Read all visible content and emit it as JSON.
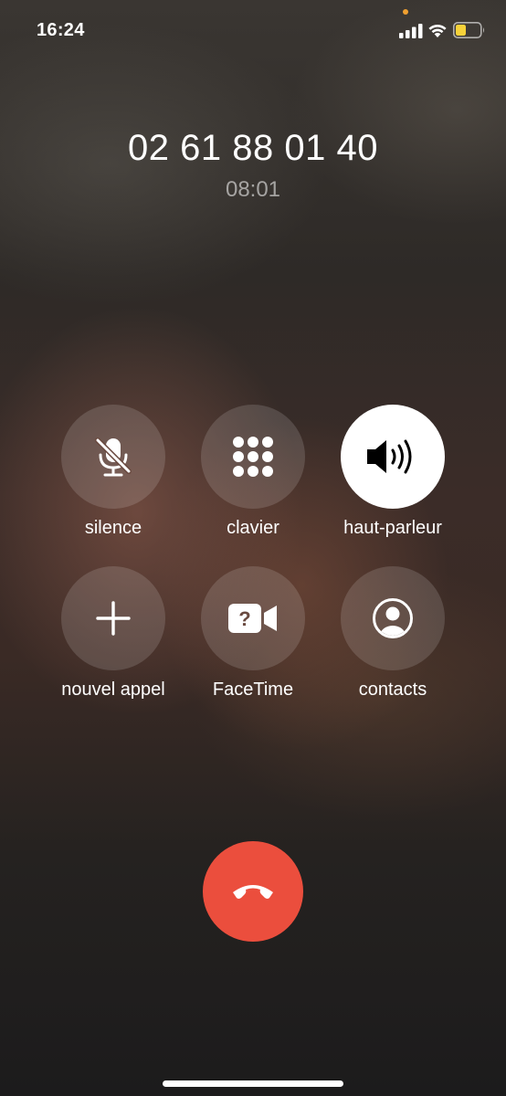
{
  "status_bar": {
    "time": "16:24"
  },
  "call": {
    "number": "02 61 88 01 40",
    "duration": "08:01"
  },
  "controls": [
    {
      "label": "silence",
      "icon": "mic-slash-icon",
      "active": false
    },
    {
      "label": "clavier",
      "icon": "keypad-icon",
      "active": false
    },
    {
      "label": "haut-parleur",
      "icon": "speaker-icon",
      "active": true
    },
    {
      "label": "nouvel appel",
      "icon": "plus-icon",
      "active": false
    },
    {
      "label": "FaceTime",
      "icon": "facetime-icon",
      "active": false
    },
    {
      "label": "contacts",
      "icon": "person-circle-icon",
      "active": false
    }
  ],
  "end_call": {
    "icon": "phone-down-icon",
    "color": "#eb4e3d"
  },
  "colors": {
    "active_button": "#ffffff",
    "battery_fill": "#f7d23a",
    "camera_indicator": "#f0a030"
  }
}
